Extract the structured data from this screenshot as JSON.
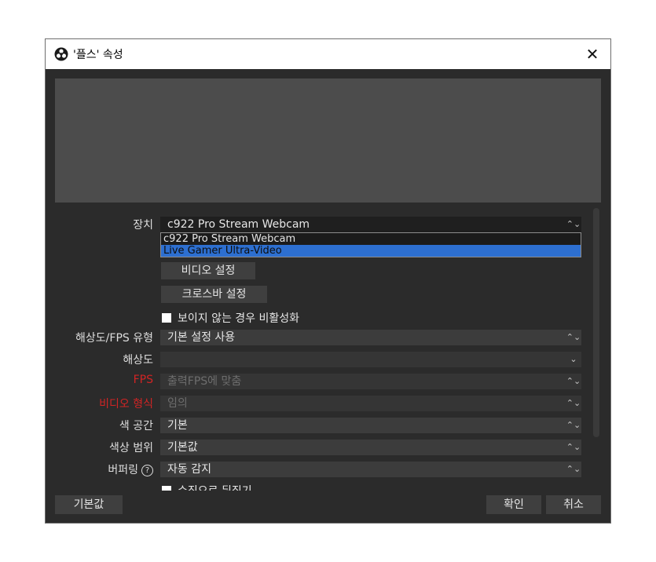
{
  "window": {
    "title": "'플스' 속성",
    "logo_icon": "obs-logo-icon",
    "close_glyph": "✕"
  },
  "device": {
    "label": "장치",
    "selected": "c922 Pro Stream Webcam",
    "options": [
      "c922 Pro Stream Webcam",
      "Live Gamer Ultra-Video"
    ],
    "highlighted_option": "Live Gamer Ultra-Video"
  },
  "buttons": {
    "video_settings": "비디오 설정",
    "crossbar_settings": "크로스바 설정"
  },
  "deactivate_when_hidden": {
    "label": "보이지 않는 경우 비활성화",
    "checked": false
  },
  "resolution_fps_type": {
    "label": "해상도/FPS 유형",
    "value": "기본 설정 사용"
  },
  "resolution": {
    "label": "해상도",
    "value": ""
  },
  "fps": {
    "label": "FPS",
    "value": "출력FPS에 맞춤"
  },
  "video_format": {
    "label": "비디오 형식",
    "value": "임의"
  },
  "color_space": {
    "label": "색 공간",
    "value": "기본"
  },
  "color_range": {
    "label": "색상 범위",
    "value": "기본값"
  },
  "buffering": {
    "label": "버퍼링",
    "value": "자동 감지",
    "help_glyph": "?"
  },
  "flip_vertical": {
    "label": "수직으로 뒤집기"
  },
  "footer": {
    "defaults": "기본값",
    "ok": "확인",
    "cancel": "취소"
  },
  "colors": {
    "accent": "#2d6fd0",
    "error_label": "#d12424",
    "background": "#2b2b2b"
  }
}
